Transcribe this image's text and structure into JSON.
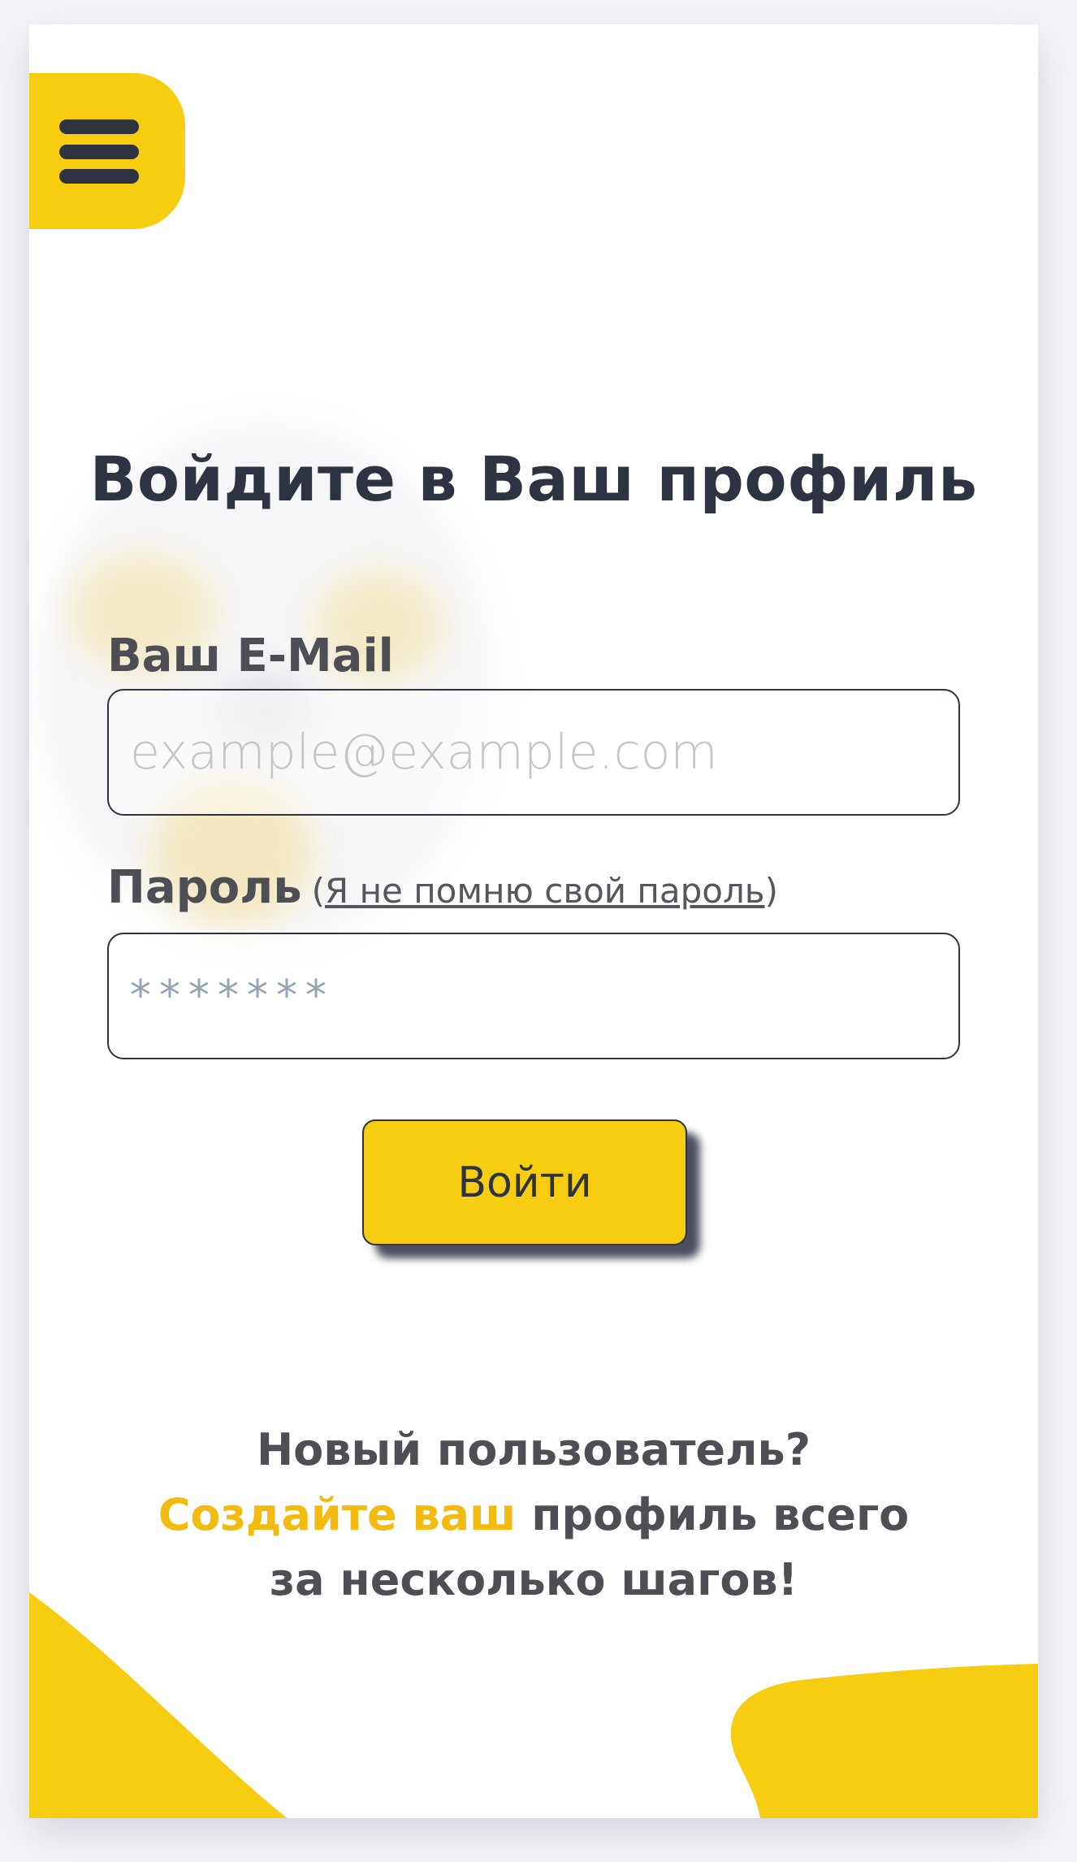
{
  "login": {
    "title": "Войдите в Ваш профиль",
    "email": {
      "label": "Ваш E-Mail",
      "placeholder": "example@example.com",
      "value": ""
    },
    "password": {
      "label": "Пароль",
      "forgot_open": "(",
      "forgot_link": "Я не помню свой пароль",
      "forgot_close": ")",
      "placeholder": "*******",
      "value": ""
    },
    "submit_label": "Войти"
  },
  "signup": {
    "question": "Новый пользователь?",
    "link_text": "Создайте ваш",
    "rest_line1": " профиль всего",
    "line2": "за несколько шагов!"
  },
  "icons": {
    "menu": "hamburger-menu-icon"
  },
  "colors": {
    "accent": "#f6cd10",
    "link_accent": "#f3bb10",
    "text_dark": "#2d3340",
    "text_muted": "#4d4f55",
    "background": "#ffffff"
  }
}
